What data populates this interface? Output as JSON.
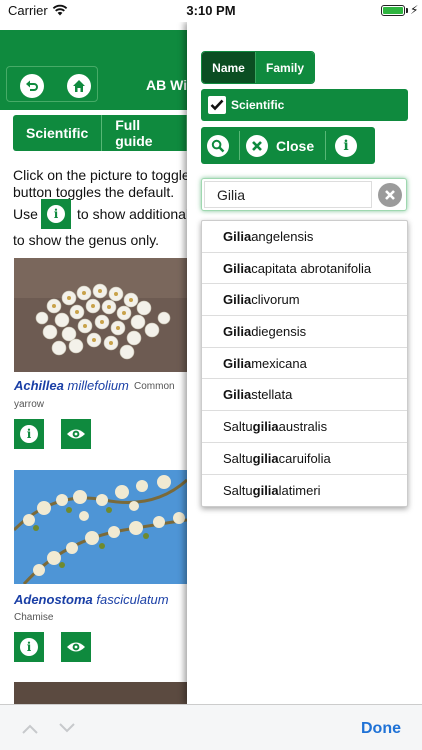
{
  "status_bar": {
    "carrier": "Carrier",
    "time": "3:10 PM"
  },
  "app": {
    "title": "AB Wi"
  },
  "tabs": [
    "Scientific",
    "Full guide"
  ],
  "intro": {
    "line1": "Click on the picture to toggle b",
    "line2": "button toggles the default.",
    "line3_pre": "Use",
    "line3_post": "to show additional i",
    "line4": "to show the genus only."
  },
  "plants": [
    {
      "genus": "Achillea",
      "species": "millefolium",
      "common_a": "Common",
      "common_b": "yarrow"
    },
    {
      "genus": "Adenostoma",
      "species": "fasciculatum",
      "common_a": "Chamise"
    }
  ],
  "drawer": {
    "segment": {
      "name_label": "Name",
      "family_label": "Family"
    },
    "scientific_label": "Scientific",
    "close_label": "Close",
    "search": {
      "value": "Gilia"
    },
    "suggestions": [
      {
        "pre": "",
        "match": "Gilia",
        "post": " angelensis"
      },
      {
        "pre": "",
        "match": "Gilia",
        "post": " capitata abrotanifolia"
      },
      {
        "pre": "",
        "match": "Gilia",
        "post": " clivorum"
      },
      {
        "pre": "",
        "match": "Gilia",
        "post": " diegensis"
      },
      {
        "pre": "",
        "match": "Gilia",
        "post": " mexicana"
      },
      {
        "pre": "",
        "match": "Gilia",
        "post": " stellata"
      },
      {
        "pre": "Saltu",
        "match": "gilia",
        "post": " australis"
      },
      {
        "pre": "Saltu",
        "match": "gilia",
        "post": " caruifolia"
      },
      {
        "pre": "Saltu",
        "match": "gilia",
        "post": " latimeri"
      }
    ]
  },
  "accessory": {
    "done_label": "Done"
  },
  "colors": {
    "primary_green": "#0f8a3e",
    "dark_green": "#0b4e22",
    "link_blue": "#1f72d6",
    "plant_name_blue": "#1a3fa6"
  }
}
